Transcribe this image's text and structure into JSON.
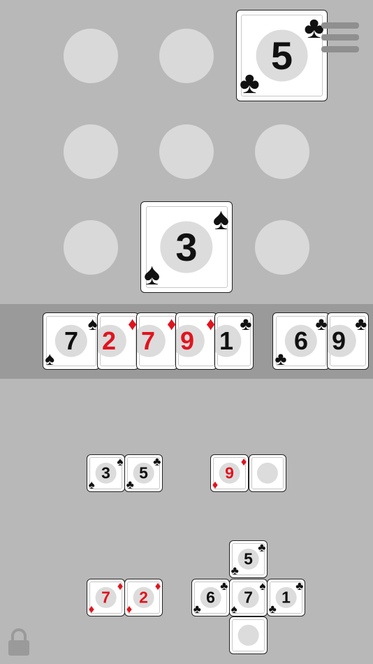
{
  "colors": {
    "background": "#b8b8b8",
    "hand_strip": "#9a9a9a",
    "red": "#e0141e",
    "black": "#111111",
    "slot": "#d9d9d9"
  },
  "board": {
    "top_card": {
      "rank": "5",
      "suit": "♣",
      "color": "black"
    },
    "center_card": {
      "rank": "3",
      "suit": "♠",
      "color": "black"
    }
  },
  "hand": {
    "cards": [
      {
        "rank": "7",
        "suit": "♠",
        "color": "black"
      },
      {
        "rank": "2",
        "suit": "♦",
        "color": "red"
      },
      {
        "rank": "7",
        "suit": "♦",
        "color": "red"
      },
      {
        "rank": "9",
        "suit": "♦",
        "color": "red"
      },
      {
        "rank": "1",
        "suit": "♣",
        "color": "black"
      },
      {
        "rank": "6",
        "suit": "♣",
        "color": "black"
      },
      {
        "rank": "9",
        "suit": "♣",
        "color": "black"
      }
    ]
  },
  "groups": {
    "pair_a": [
      {
        "rank": "3",
        "suit": "♠",
        "color": "black"
      },
      {
        "rank": "5",
        "suit": "♣",
        "color": "black"
      }
    ],
    "pair_b": [
      {
        "rank": "9",
        "suit": "♦",
        "color": "red"
      }
    ],
    "pair_c": [
      {
        "rank": "7",
        "suit": "♦",
        "color": "red"
      },
      {
        "rank": "2",
        "suit": "♦",
        "color": "red"
      }
    ],
    "cross": {
      "top": {
        "rank": "5",
        "suit": "♣",
        "color": "black"
      },
      "left": {
        "rank": "6",
        "suit": "♣",
        "color": "black"
      },
      "center": {
        "rank": "7",
        "suit": "♠",
        "color": "black"
      },
      "right": {
        "rank": "1",
        "suit": "♣",
        "color": "black"
      }
    }
  },
  "icons": {
    "menu": "hamburger-menu-icon",
    "lock": "lock-icon"
  }
}
